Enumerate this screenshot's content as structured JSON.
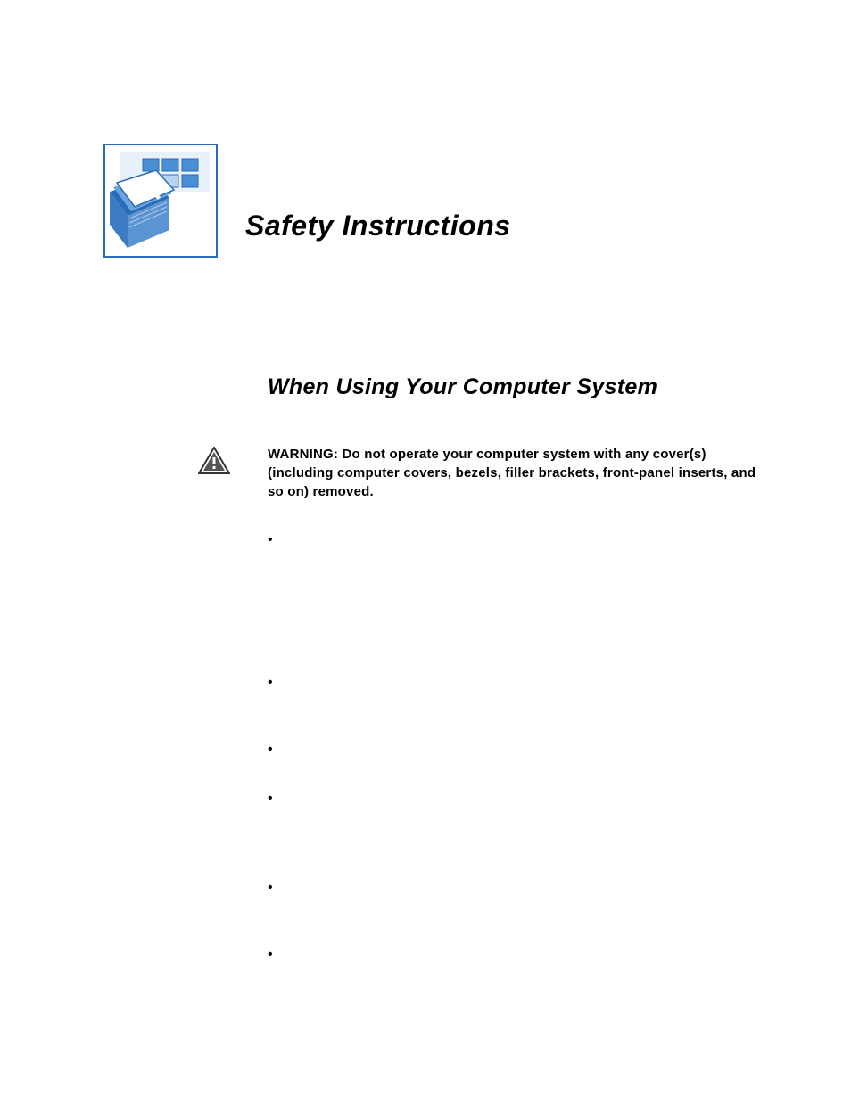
{
  "title": "Safety Instructions",
  "section_heading": "When Using Your Computer System",
  "warning": {
    "label": "WARNING: ",
    "text": "Do not operate your computer system with any cover(s) (including computer covers, bezels, filler brackets, front-panel inserts, and so on) removed."
  },
  "bullets": [
    "",
    "",
    "",
    "",
    "",
    ""
  ]
}
